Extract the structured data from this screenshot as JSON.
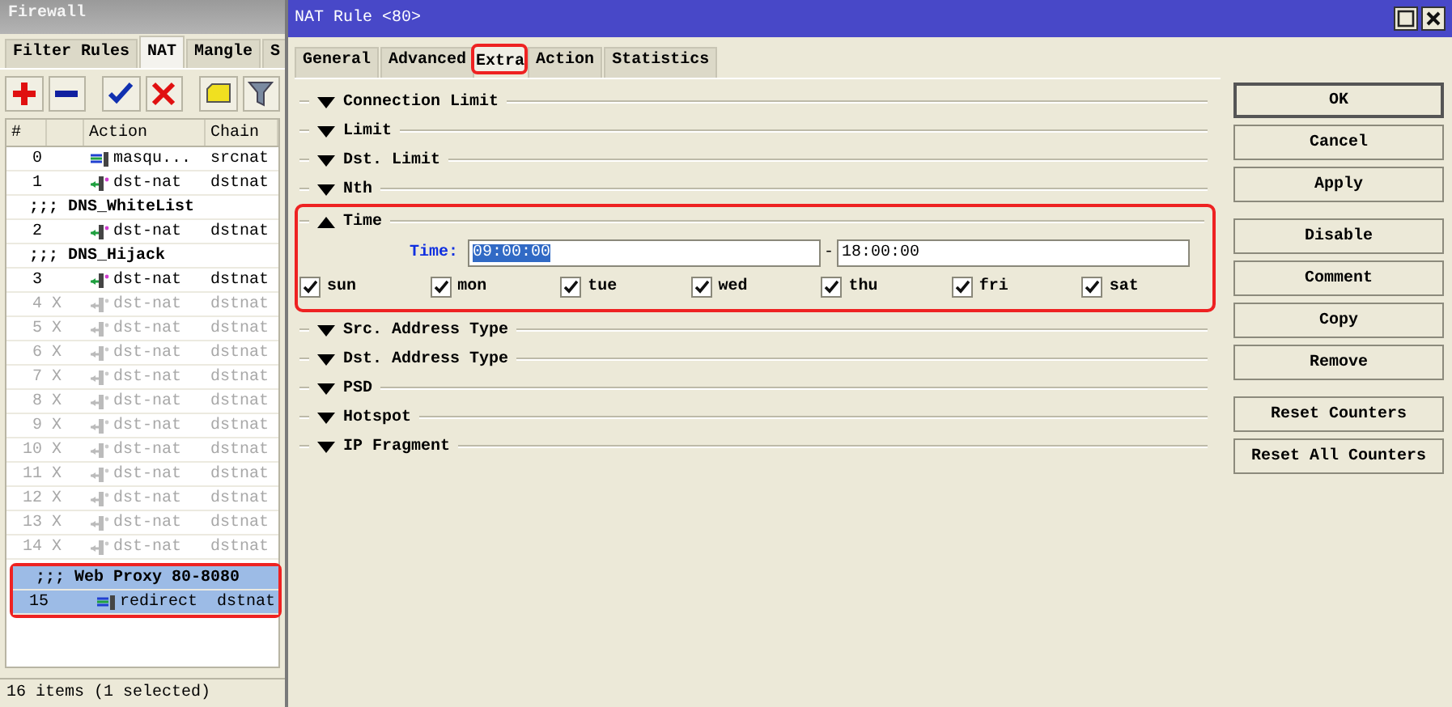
{
  "firewall": {
    "title": "Firewall",
    "tabs": [
      {
        "label": "Filter Rules",
        "selected": false
      },
      {
        "label": "NAT",
        "selected": true
      },
      {
        "label": "Mangle",
        "selected": false
      },
      {
        "label": "S",
        "selected": false
      }
    ],
    "toolbar": [
      {
        "kind": "add"
      },
      {
        "kind": "remove"
      },
      {
        "kind": "enable"
      },
      {
        "kind": "disable"
      },
      {
        "kind": "comment"
      },
      {
        "kind": "filter"
      }
    ],
    "table": {
      "columns": [
        "#",
        "Action",
        "Chain"
      ],
      "rows": [
        {
          "kind": "swap",
          "number": "0",
          "disabled": false,
          "action": "masqu...",
          "chain": "srcnat",
          "selected": false
        },
        {
          "kind": "arrow",
          "number": "1",
          "disabled": false,
          "action": "dst-nat",
          "chain": "dstnat",
          "selected": false
        },
        {
          "kind": "comment",
          "text": ";;; DNS_WhiteList",
          "selected": false
        },
        {
          "kind": "arrow",
          "number": "2",
          "disabled": false,
          "action": "dst-nat",
          "chain": "dstnat",
          "selected": false
        },
        {
          "kind": "comment",
          "text": ";;; DNS_Hijack",
          "selected": false
        },
        {
          "kind": "arrow",
          "number": "3",
          "disabled": false,
          "action": "dst-nat",
          "chain": "dstnat",
          "selected": false
        },
        {
          "kind": "arrow",
          "number": "4",
          "disabled": true,
          "flag": "X",
          "action": "dst-nat",
          "chain": "dstnat",
          "selected": false
        },
        {
          "kind": "arrow",
          "number": "5",
          "disabled": true,
          "flag": "X",
          "action": "dst-nat",
          "chain": "dstnat",
          "selected": false
        },
        {
          "kind": "arrow",
          "number": "6",
          "disabled": true,
          "flag": "X",
          "action": "dst-nat",
          "chain": "dstnat",
          "selected": false
        },
        {
          "kind": "arrow",
          "number": "7",
          "disabled": true,
          "flag": "X",
          "action": "dst-nat",
          "chain": "dstnat",
          "selected": false
        },
        {
          "kind": "arrow",
          "number": "8",
          "disabled": true,
          "flag": "X",
          "action": "dst-nat",
          "chain": "dstnat",
          "selected": false
        },
        {
          "kind": "arrow",
          "number": "9",
          "disabled": true,
          "flag": "X",
          "action": "dst-nat",
          "chain": "dstnat",
          "selected": false
        },
        {
          "kind": "arrow",
          "number": "10",
          "disabled": true,
          "flag": "X",
          "action": "dst-nat",
          "chain": "dstnat",
          "selected": false
        },
        {
          "kind": "arrow",
          "number": "11",
          "disabled": true,
          "flag": "X",
          "action": "dst-nat",
          "chain": "dstnat",
          "selected": false
        },
        {
          "kind": "arrow",
          "number": "12",
          "disabled": true,
          "flag": "X",
          "action": "dst-nat",
          "chain": "dstnat",
          "selected": false
        },
        {
          "kind": "arrow",
          "number": "13",
          "disabled": true,
          "flag": "X",
          "action": "dst-nat",
          "chain": "dstnat",
          "selected": false
        },
        {
          "kind": "arrow",
          "number": "14",
          "disabled": true,
          "flag": "X",
          "action": "dst-nat",
          "chain": "dstnat",
          "selected": false
        },
        {
          "kind": "comment",
          "text": ";;; Web Proxy 80-8080",
          "selected": true,
          "highlighted": true
        },
        {
          "kind": "swap",
          "number": "15",
          "disabled": false,
          "action": "redirect",
          "chain": "dstnat",
          "selected": true,
          "highlighted": true
        }
      ]
    },
    "status_bar": "16 items (1 selected)"
  },
  "nat_rule": {
    "title": "NAT Rule <80>",
    "tabs": [
      {
        "label": "General",
        "selected": false
      },
      {
        "label": "Advanced",
        "selected": false
      },
      {
        "label": "Extra",
        "selected": true,
        "highlighted": true
      },
      {
        "label": "Action",
        "selected": false
      },
      {
        "label": "Statistics",
        "selected": false
      }
    ],
    "sections": [
      {
        "label": "Connection Limit",
        "expanded": false
      },
      {
        "label": "Limit",
        "expanded": false
      },
      {
        "label": "Dst. Limit",
        "expanded": false
      },
      {
        "label": "Nth",
        "expanded": false
      },
      {
        "label": "Time",
        "expanded": true,
        "highlighted": true,
        "field_label": "Time:",
        "from": "09:00:00",
        "from_selected": true,
        "separator": "-",
        "to": "18:00:00",
        "days": [
          {
            "label": "sun",
            "checked": true
          },
          {
            "label": "mon",
            "checked": true
          },
          {
            "label": "tue",
            "checked": true
          },
          {
            "label": "wed",
            "checked": true
          },
          {
            "label": "thu",
            "checked": true
          },
          {
            "label": "fri",
            "checked": true
          },
          {
            "label": "sat",
            "checked": true
          }
        ]
      },
      {
        "label": "Src. Address Type",
        "expanded": false
      },
      {
        "label": "Dst. Address Type",
        "expanded": false
      },
      {
        "label": "PSD",
        "expanded": false
      },
      {
        "label": "Hotspot",
        "expanded": false
      },
      {
        "label": "IP Fragment",
        "expanded": false
      }
    ],
    "button_groups": [
      [
        {
          "label": "OK",
          "default": true
        },
        {
          "label": "Cancel",
          "default": false
        },
        {
          "label": "Apply",
          "default": false
        }
      ],
      [
        {
          "label": "Disable",
          "default": false
        },
        {
          "label": "Comment",
          "default": false
        },
        {
          "label": "Copy",
          "default": false
        },
        {
          "label": "Remove",
          "default": false
        }
      ],
      [
        {
          "label": "Reset Counters",
          "default": false
        },
        {
          "label": "Reset All Counters",
          "default": false
        }
      ]
    ]
  }
}
